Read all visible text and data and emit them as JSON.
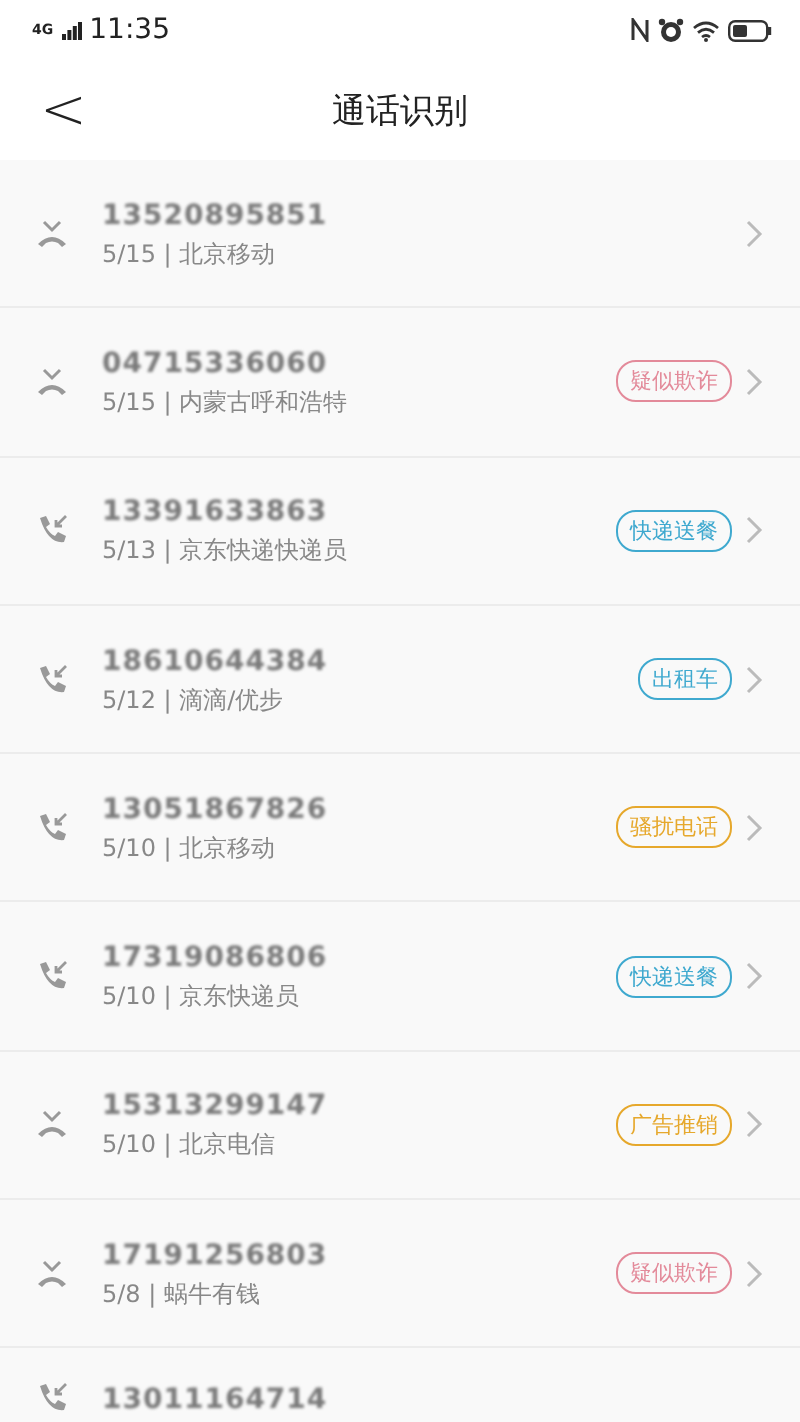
{
  "status_bar": {
    "network": "4G",
    "time": "11:35"
  },
  "nav": {
    "back": "<",
    "title": "通话识别"
  },
  "calls": [
    {
      "kind": "missed",
      "number": "13520895851",
      "detail": "5/15 | 北京移动"
    },
    {
      "kind": "missed",
      "number": "04715336060",
      "detail": "5/15 | 内蒙古呼和浩特",
      "tag": {
        "label": "疑似欺诈",
        "color": "#e38a9a"
      }
    },
    {
      "kind": "incoming",
      "number": "13391633863",
      "detail": "5/13 | 京东快递快递员",
      "tag": {
        "label": "快递送餐",
        "color": "#3fa9cf"
      }
    },
    {
      "kind": "incoming",
      "number": "18610644384",
      "detail": "5/12 | 滴滴/优步",
      "tag": {
        "label": "出租车",
        "color": "#3fa9cf"
      }
    },
    {
      "kind": "incoming",
      "number": "13051867826",
      "detail": "5/10 | 北京移动",
      "tag": {
        "label": "骚扰电话",
        "color": "#e6a82c"
      }
    },
    {
      "kind": "incoming",
      "number": "17319086806",
      "detail": "5/10 | 京东快递员",
      "tag": {
        "label": "快递送餐",
        "color": "#3fa9cf"
      }
    },
    {
      "kind": "missed",
      "number": "15313299147",
      "detail": "5/10 | 北京电信",
      "tag": {
        "label": "广告推销",
        "color": "#e6a82c"
      }
    },
    {
      "kind": "missed",
      "number": "17191256803",
      "detail": "5/8 | 蜗牛有钱",
      "tag": {
        "label": "疑似欺诈",
        "color": "#e38a9a"
      }
    },
    {
      "kind": "incoming",
      "number": "13011164714"
    }
  ]
}
